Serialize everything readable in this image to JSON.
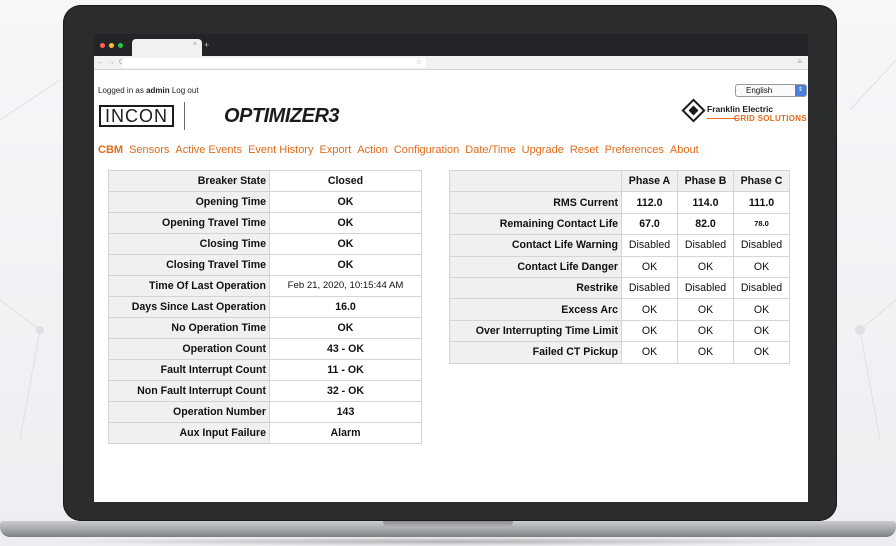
{
  "browser": {
    "tab_close": "×",
    "new_tab": "+",
    "nav_icons": "← → C",
    "star": "☆",
    "menu": "≡"
  },
  "login": {
    "prefix": "Logged in as",
    "user": "admin",
    "logout": "Log out"
  },
  "language": {
    "selected": "English",
    "arrow": "⇕"
  },
  "brand": {
    "incon": "INCON",
    "product": "OPTIMIZER3",
    "fe_name": "Franklin Electric",
    "fe_sub": "GRID SOLUTIONS"
  },
  "nav": [
    "CBM",
    "Sensors",
    "Active Events",
    "Event History",
    "Export",
    "Action",
    "Configuration",
    "Date/Time",
    "Upgrade",
    "Reset",
    "Preferences",
    "About"
  ],
  "cbm_table": [
    {
      "label": "Breaker State",
      "value": "Closed"
    },
    {
      "label": "Opening Time",
      "value": "OK"
    },
    {
      "label": "Opening Travel Time",
      "value": "OK"
    },
    {
      "label": "Closing Time",
      "value": "OK"
    },
    {
      "label": "Closing Travel Time",
      "value": "OK"
    },
    {
      "label": "Time Of Last Operation",
      "value": "Feb 21, 2020, 10:15:44 AM"
    },
    {
      "label": "Days Since Last Operation",
      "value": "16.0"
    },
    {
      "label": "No Operation Time",
      "value": "OK"
    },
    {
      "label": "Operation Count",
      "value": "43 - OK"
    },
    {
      "label": "Fault Interrupt Count",
      "value": "11 - OK"
    },
    {
      "label": "Non Fault Interrupt Count",
      "value": "32 - OK"
    },
    {
      "label": "Operation Number",
      "value": "143"
    },
    {
      "label": "Aux Input Failure",
      "value": "Alarm"
    }
  ],
  "phase_table": {
    "headers": [
      "Phase A",
      "Phase B",
      "Phase C"
    ],
    "rows": [
      {
        "label": "RMS Current",
        "values": [
          "112.0",
          "114.0",
          "111.0"
        ]
      },
      {
        "label": "Remaining Contact Life",
        "values": [
          "67.0",
          "82.0",
          "78.0"
        ]
      },
      {
        "label": "Contact Life Warning",
        "values": [
          "Disabled",
          "Disabled",
          "Disabled"
        ]
      },
      {
        "label": "Contact Life Danger",
        "values": [
          "OK",
          "OK",
          "OK"
        ]
      },
      {
        "label": "Restrike",
        "values": [
          "Disabled",
          "Disabled",
          "Disabled"
        ]
      },
      {
        "label": "Excess Arc",
        "values": [
          "OK",
          "OK",
          "OK"
        ]
      },
      {
        "label": "Over Interrupting Time Limit",
        "values": [
          "OK",
          "OK",
          "OK"
        ]
      },
      {
        "label": "Failed CT Pickup",
        "values": [
          "OK",
          "OK",
          "OK"
        ]
      }
    ]
  },
  "colors": {
    "accent": "#e06b1a",
    "label_bg": "#f0f0f0",
    "border": "#d4d4d4",
    "laptop_bezel": "#2b2c2e"
  }
}
